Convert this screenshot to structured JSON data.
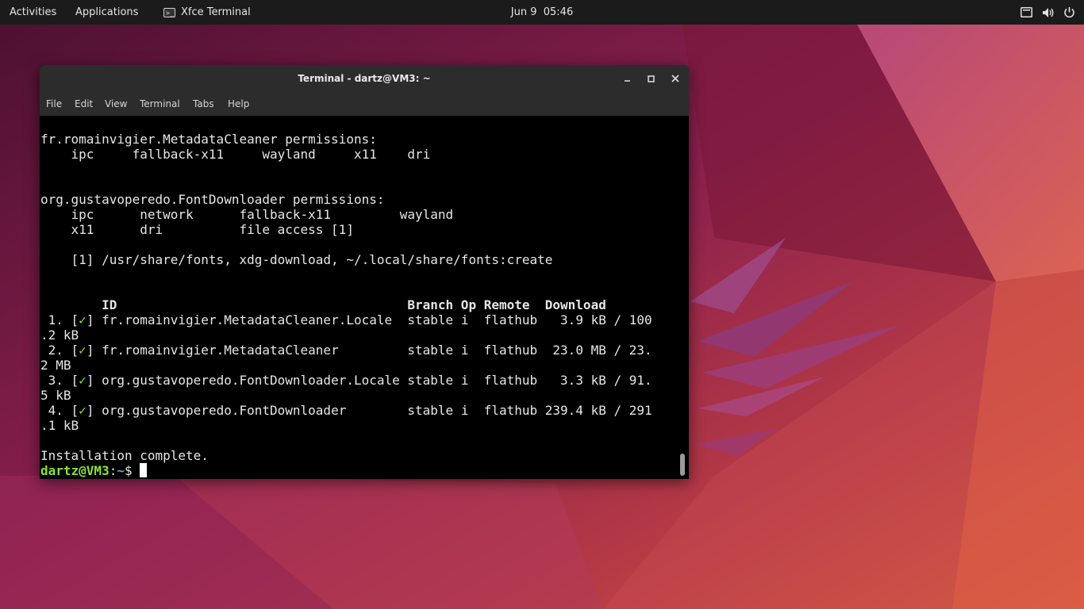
{
  "topbar": {
    "activities": "Activities",
    "applications": "Applications",
    "app_name": "Xfce Terminal",
    "clock_date": "Jun 9",
    "clock_time": "05:46",
    "tray_icons": [
      "display-icon",
      "volume-icon",
      "power-icon"
    ]
  },
  "window": {
    "title": "Terminal - dartz@VM3: ~",
    "buttons": [
      "minimize",
      "maximize",
      "close"
    ]
  },
  "menubar": {
    "file": "File",
    "edit": "Edit",
    "view": "View",
    "terminal": "Terminal",
    "tabs": "Tabs",
    "help": "Help"
  },
  "terminal": {
    "mc_header": "fr.romainvigier.MetadataCleaner permissions:",
    "mc_perms": "    ipc     fallback-x11     wayland     x11    dri",
    "fd_header": "org.gustavoperedo.FontDownloader permissions:",
    "fd_perms1": "    ipc      network      fallback-x11         wayland",
    "fd_perms2": "    x11      dri          file access [1]",
    "fd_note": "    [1] /usr/share/fonts, xdg-download, ~/.local/share/fonts:create",
    "table_header": "        ID                                      Branch Op Remote  Download",
    "rows": [
      {
        "prefix": " 1. [",
        "check": "✓",
        "rest": "] fr.romainvigier.MetadataCleaner.Locale  stable i  flathub   3.9 kB / 100",
        "wrap": ".2 kB"
      },
      {
        "prefix": " 2. [",
        "check": "✓",
        "rest": "] fr.romainvigier.MetadataCleaner         stable i  flathub  23.0 MB / 23.",
        "wrap": "2 MB"
      },
      {
        "prefix": " 3. [",
        "check": "✓",
        "rest": "] org.gustavoperedo.FontDownloader.Locale stable i  flathub   3.3 kB / 91.",
        "wrap": "5 kB"
      },
      {
        "prefix": " 4. [",
        "check": "✓",
        "rest": "] org.gustavoperedo.FontDownloader        stable i  flathub 239.4 kB / 291",
        "wrap": ".1 kB"
      }
    ],
    "complete": "Installation complete.",
    "prompt_user": "dartz@VM3",
    "prompt_sep": ":",
    "prompt_path": "~",
    "prompt_symbol": "$ "
  },
  "colors": {
    "prompt_user": "#8ae234",
    "prompt_path": "#729fcf",
    "checkmark": "#8ae234",
    "titlebar": "#2c2c2c",
    "topbar": "#1b1b1b"
  }
}
